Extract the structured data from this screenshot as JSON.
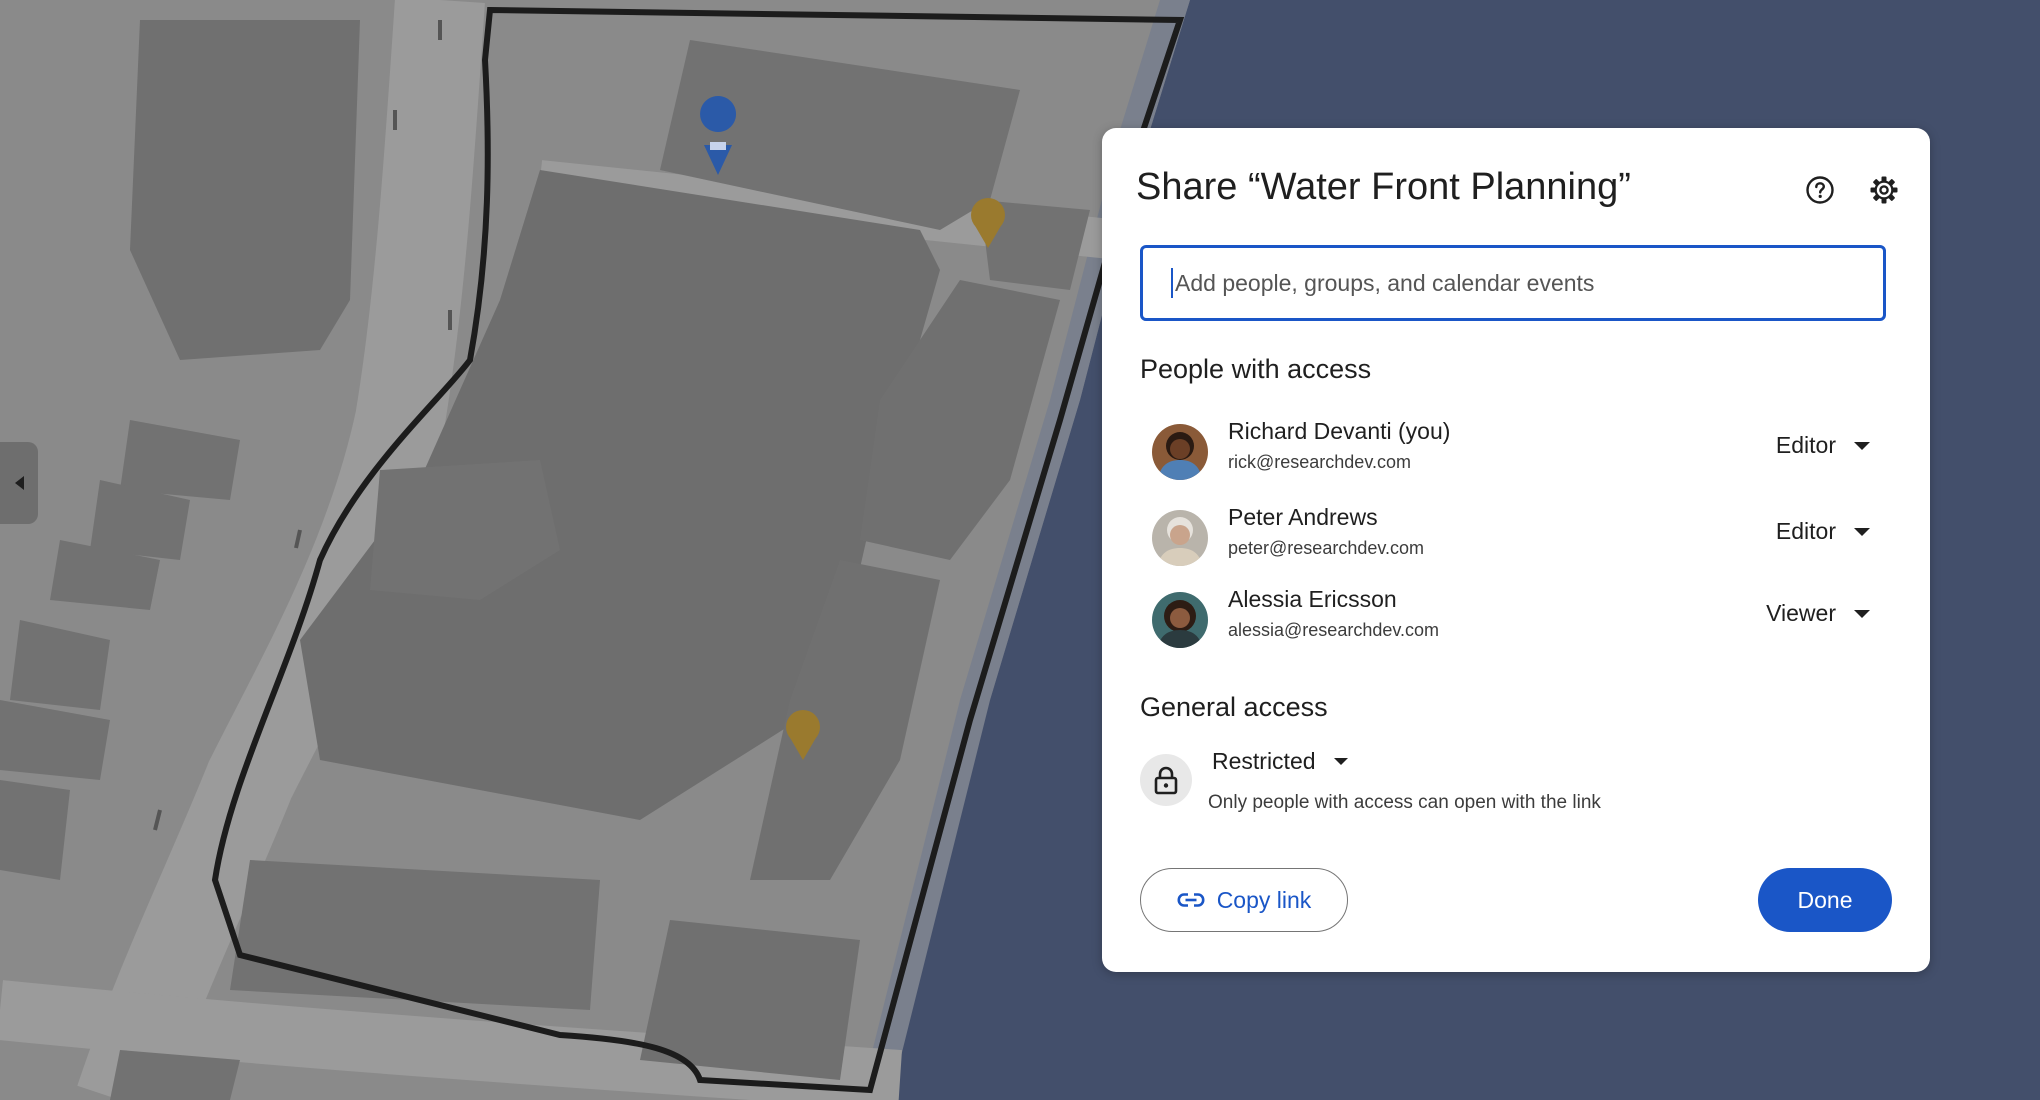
{
  "dialog": {
    "title": "Share “Water Front Planning”",
    "search_placeholder": "Add people, groups, and calendar events",
    "people_section_title": "People with access",
    "people": [
      {
        "name": "Richard Devanti (you)",
        "email": "rick@researchdev.com",
        "role": "Editor"
      },
      {
        "name": "Peter Andrews",
        "email": "peter@researchdev.com",
        "role": "Editor"
      },
      {
        "name": "Alessia Ericsson",
        "email": "alessia@researchdev.com",
        "role": "Viewer"
      }
    ],
    "general_access_title": "General access",
    "general_access_value": "Restricted",
    "general_access_desc": "Only people with access can open with the link",
    "copy_link_label": "Copy link",
    "done_label": "Done"
  },
  "colors": {
    "accent": "#1a56c7",
    "water": "#434f6b",
    "map_overlay": "#8a8a8a"
  },
  "icons": {
    "help": "help-icon",
    "settings": "gear-icon",
    "lock": "lock-icon",
    "link": "link-icon",
    "shopping_pin": "shopping-cart-pin-icon",
    "restaurant_pin": "restaurant-pin-icon"
  }
}
